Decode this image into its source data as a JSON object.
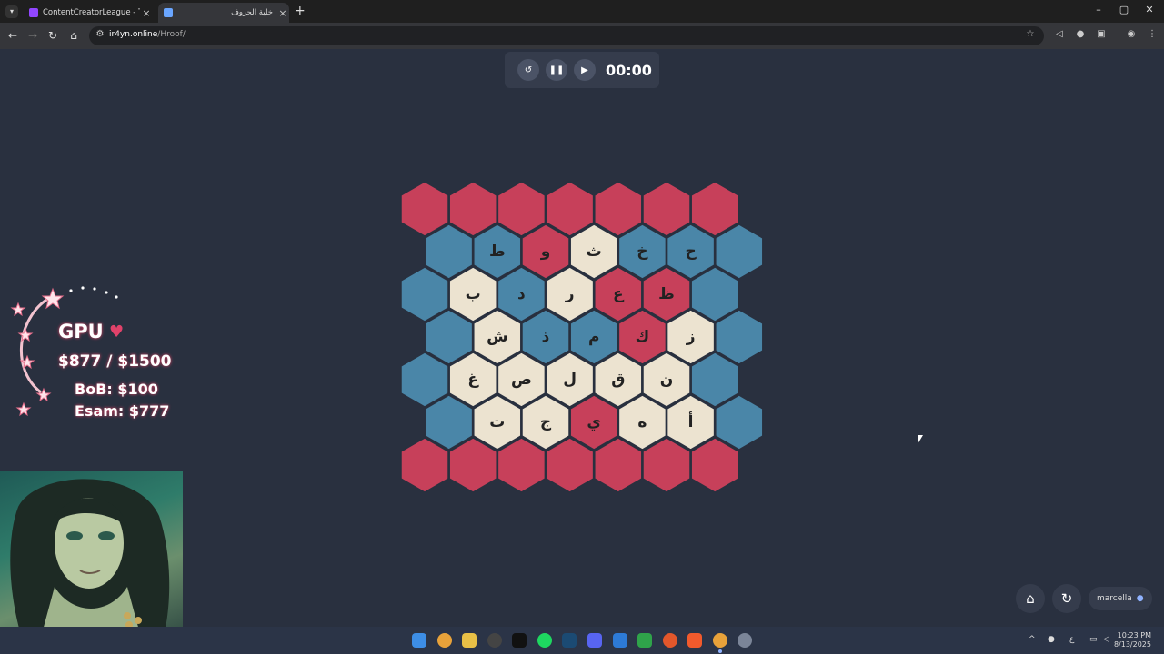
{
  "browser": {
    "tabs": [
      {
        "title": "ContentCreatorLeague - Twitch",
        "active": false,
        "favicon_color": "#9146ff"
      },
      {
        "title": "خلية الحروف",
        "active": true,
        "favicon_color": "#6aa6ff"
      }
    ],
    "url_domain": "ir4yn.online",
    "url_path": "/Hroof/"
  },
  "timer": {
    "display": "00:00"
  },
  "board": {
    "colors": {
      "red": "#c7405a",
      "blue": "#4a86a8",
      "cream": "#ece3d0"
    },
    "rows": [
      [
        {
          "c": "red"
        },
        {
          "c": "red"
        },
        {
          "c": "red"
        },
        {
          "c": "red"
        },
        {
          "c": "red"
        },
        {
          "c": "red"
        },
        {
          "c": "red"
        }
      ],
      [
        {
          "c": "blue"
        },
        {
          "c": "blue",
          "l": "ط"
        },
        {
          "c": "red",
          "l": "و"
        },
        {
          "c": "cream",
          "l": "ث"
        },
        {
          "c": "blue",
          "l": "خ"
        },
        {
          "c": "blue",
          "l": "ح"
        },
        {
          "c": "blue"
        }
      ],
      [
        {
          "c": "blue"
        },
        {
          "c": "cream",
          "l": "ب"
        },
        {
          "c": "blue",
          "l": "د"
        },
        {
          "c": "cream",
          "l": "ر"
        },
        {
          "c": "red",
          "l": "ع"
        },
        {
          "c": "red",
          "l": "ظ"
        },
        {
          "c": "blue"
        }
      ],
      [
        {
          "c": "blue"
        },
        {
          "c": "cream",
          "l": "ش"
        },
        {
          "c": "blue",
          "l": "ذ"
        },
        {
          "c": "blue",
          "l": "م"
        },
        {
          "c": "red",
          "l": "ك"
        },
        {
          "c": "cream",
          "l": "ز"
        },
        {
          "c": "blue"
        }
      ],
      [
        {
          "c": "blue"
        },
        {
          "c": "cream",
          "l": "غ"
        },
        {
          "c": "cream",
          "l": "ص"
        },
        {
          "c": "cream",
          "l": "ل"
        },
        {
          "c": "cream",
          "l": "ق"
        },
        {
          "c": "cream",
          "l": "ن"
        },
        {
          "c": "blue"
        }
      ],
      [
        {
          "c": "blue"
        },
        {
          "c": "cream",
          "l": "ت"
        },
        {
          "c": "cream",
          "l": "ج"
        },
        {
          "c": "red",
          "l": "ي"
        },
        {
          "c": "cream",
          "l": "ه"
        },
        {
          "c": "cream",
          "l": "أ"
        },
        {
          "c": "blue"
        }
      ],
      [
        {
          "c": "red"
        },
        {
          "c": "red"
        },
        {
          "c": "red"
        },
        {
          "c": "red"
        },
        {
          "c": "red"
        },
        {
          "c": "red"
        },
        {
          "c": "red"
        }
      ]
    ]
  },
  "stream_overlay": {
    "gpu_label": "GPU",
    "gpu_amount": "$877 / $1500",
    "donor1": "BoB: $100",
    "donor2": "Esam: $777"
  },
  "user": {
    "name": "marcella"
  },
  "taskbar": {
    "time": "10:23 PM",
    "date": "8/13/2025",
    "apps": [
      "windows",
      "chrome",
      "explorer",
      "obs",
      "tiktok",
      "spotify",
      "steam",
      "discord",
      "app-blue",
      "app-green",
      "app-orange",
      "brave",
      "chrome-active",
      "settings"
    ]
  }
}
